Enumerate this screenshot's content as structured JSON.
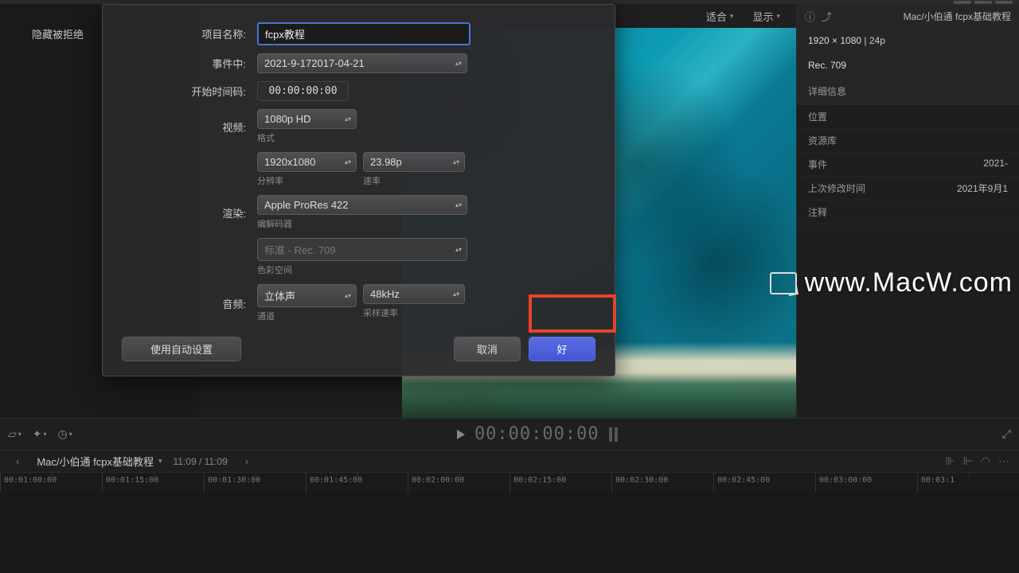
{
  "top": {
    "hide_rejected": "隐藏被拒绝"
  },
  "viewer": {
    "fit_label": "适合",
    "display_label": "显示",
    "timecode": "00:00:00:00"
  },
  "inspector": {
    "title": "Mac/小伯通 fcpx基础教程",
    "resolution": "1920 × 1080",
    "fps": "24p",
    "colorspace": "Rec. 709",
    "section_detail": "详细信息",
    "rows": {
      "location": "位置",
      "library": "资源库",
      "event": "事件",
      "event_val": "2021-",
      "modified": "上次修改时间",
      "modified_val": "2021年9月1",
      "notes": "注释"
    }
  },
  "dialog": {
    "labels": {
      "project_name": "项目名称:",
      "in_event": "事件中:",
      "start_tc": "开始时间码:",
      "video": "视频:",
      "render": "渲染:",
      "audio": "音频:"
    },
    "project_name_value": "fcpx教程",
    "in_event_value": "2021-9-172017-04-21",
    "start_tc_value": "00:00:00:00",
    "video_format": "1080p HD",
    "video_format_sub": "格式",
    "resolution": "1920x1080",
    "resolution_sub": "分辨率",
    "rate": "23.98p",
    "rate_sub": "速率",
    "render_codec": "Apple ProRes 422",
    "render_sub": "编解码器",
    "color_space": "标准 - Rec. 709",
    "color_space_sub": "色彩空间",
    "audio_channels": "立体声",
    "audio_channels_sub": "通道",
    "audio_rate": "48kHz",
    "audio_rate_sub": "采样速率",
    "use_auto": "使用自动设置",
    "cancel": "取消",
    "ok": "好"
  },
  "timeline": {
    "title": "Mac/小伯通 fcpx基础教程",
    "duration": "11:09 / 11:09",
    "ruler": [
      "00:01:00:00",
      "00:01:15:00",
      "00:01:30:00",
      "00:01:45:00",
      "00:02:00:00",
      "00:02:15:00",
      "00:02:30:00",
      "00:02:45:00",
      "00:03:00:00",
      "00:03:1"
    ]
  },
  "watermark": "www.MacW.com"
}
